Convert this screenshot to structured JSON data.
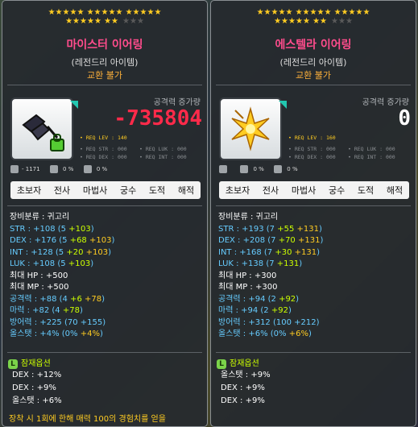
{
  "colors": {
    "name": "#ff4c8c",
    "trade": "#ffb13a",
    "stat_base": "#66ccff",
    "stat_bonus": "#ccff00",
    "stat_scroll": "#ffcc22",
    "atk_negative": "#ff2a4a"
  },
  "tooltips": [
    {
      "stars_row1": "★★★★★ ★★★★★ ★★★★★",
      "stars_row2_on": "★★★★★ ★★",
      "stars_row2_off": "★★★",
      "name": "마이스터 이어링",
      "grade": "(레전드리 아이템)",
      "trade": "교환 불가",
      "atk_label": "공격력 증가량",
      "atk_value": "-735804",
      "req_lev": "• REQ LEV : 140",
      "req_str": "• REQ STR : 000",
      "req_luk": "• REQ LUK : 000",
      "req_dex": "• REQ DEX : 000",
      "req_int": "• REQ INT : 000",
      "stat_a": "- 1171",
      "stat_b": "0 %",
      "stat_c": "0 %",
      "jobs": [
        "초보자",
        "전사",
        "마법사",
        "궁수",
        "도적",
        "해적"
      ],
      "category": "장비분류 : 귀고리",
      "stats": [
        {
          "label": "STR : +108 (5 ",
          "b": "+103",
          "c": "",
          "end": ")"
        },
        {
          "label": "DEX : +176 (5 ",
          "b": "+68",
          "c": " +103",
          "end": ")"
        },
        {
          "label": "INT : +128 (5 ",
          "b": "+20",
          "c": " +103",
          "end": ")"
        },
        {
          "label": "LUK : +108 (5 ",
          "b": "+103",
          "c": "",
          "end": ")"
        }
      ],
      "hp": "최대 HP : +500",
      "mp": "최대 MP : +500",
      "atk": {
        "label": "공격력 : +88 (4 ",
        "b": "+6",
        "c": " +78",
        "end": ")"
      },
      "mag": {
        "label": "마력 : +82 (4 ",
        "b": "+78",
        "end": ")"
      },
      "def": "방어력 : +225 (70 +155)",
      "allstat": {
        "label": "올스탯 : +4% (0% ",
        "b": "+4%",
        "end": ")"
      },
      "potential_title": "잠재옵션",
      "potentials": [
        "DEX : +12%",
        "DEX : +9%",
        "올스탯 : +6%"
      ],
      "desc": "장착 시 1회에 한해 매력 100의 경험치를 얻을"
    },
    {
      "stars_row1": "★★★★★ ★★★★★ ★★★★★",
      "stars_row2_on": "★★★★★ ★★",
      "stars_row2_off": "★★★",
      "name": "에스텔라 이어링",
      "grade": "(레전드리 아이템)",
      "trade": "교환 불가",
      "atk_label": "공격력 증가량",
      "atk_value": "0",
      "req_lev": "• REQ LEV : 160",
      "req_str": "• REQ STR : 000",
      "req_luk": "• REQ LUK : 000",
      "req_dex": "• REQ DEX : 000",
      "req_int": "• REQ INT : 000",
      "stat_a": "",
      "stat_b": "0 %",
      "stat_c": "0 %",
      "jobs": [
        "초보자",
        "전사",
        "마법사",
        "궁수",
        "도적",
        "해적"
      ],
      "category": "장비분류 : 귀고리",
      "stats": [
        {
          "label": "STR : +193 (7 ",
          "b": "+55",
          "c": " +131",
          "end": ")"
        },
        {
          "label": "DEX : +208 (7 ",
          "b": "+70",
          "c": " +131",
          "end": ")"
        },
        {
          "label": "INT : +168 (7 ",
          "b": "+30",
          "c": " +131",
          "end": ")"
        },
        {
          "label": "LUK : +138 (7 ",
          "b": "+131",
          "c": "",
          "end": ")"
        }
      ],
      "hp": "최대 HP : +300",
      "mp": "최대 MP : +300",
      "atk": {
        "label": "공격력 : +94 (2 ",
        "b": "+92",
        "c": "",
        "end": ")"
      },
      "mag": {
        "label": "마력 : +94 (2 ",
        "b": "+92",
        "end": ")"
      },
      "def": "방어력 : +312 (100 +212)",
      "allstat": {
        "label": "올스탯 : +6% (0% ",
        "b": "+6%",
        "end": ")"
      },
      "potential_title": "잠재옵션",
      "potentials": [
        "올스탯 : +9%",
        "DEX : +9%",
        "DEX : +9%"
      ],
      "desc": ""
    }
  ]
}
